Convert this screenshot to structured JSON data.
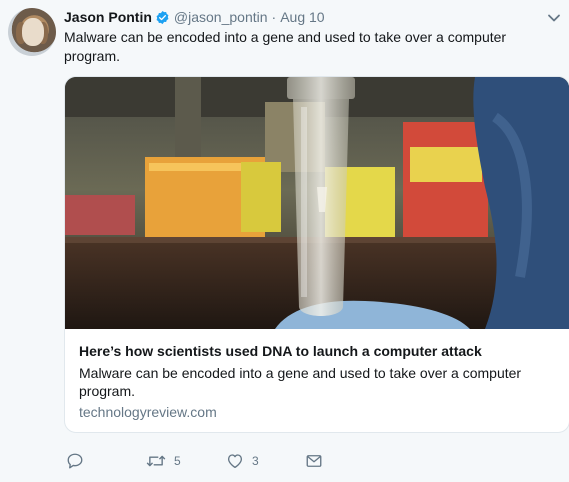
{
  "tweet": {
    "author_name": "Jason Pontin",
    "handle": "@jason_pontin",
    "separator": "·",
    "time": "Aug 10",
    "text": "Malware can be encoded into a gene and used to take over a computer program."
  },
  "card": {
    "title": "Here’s how scientists used DNA to launch a computer attack",
    "description": "Malware can be encoded into a gene and used to take over a computer program.",
    "domain": "technologyreview.com"
  },
  "actions": {
    "reply_count": "",
    "retweet_count": "5",
    "like_count": "3"
  },
  "icons": {
    "verified": "verified-badge-icon",
    "menu": "chevron-down-icon",
    "reply": "reply-icon",
    "retweet": "retweet-icon",
    "like": "heart-icon",
    "dm": "envelope-icon"
  },
  "colors": {
    "accent": "#1da1f2",
    "secondary_text": "#657786",
    "background": "#f5f8fa"
  }
}
